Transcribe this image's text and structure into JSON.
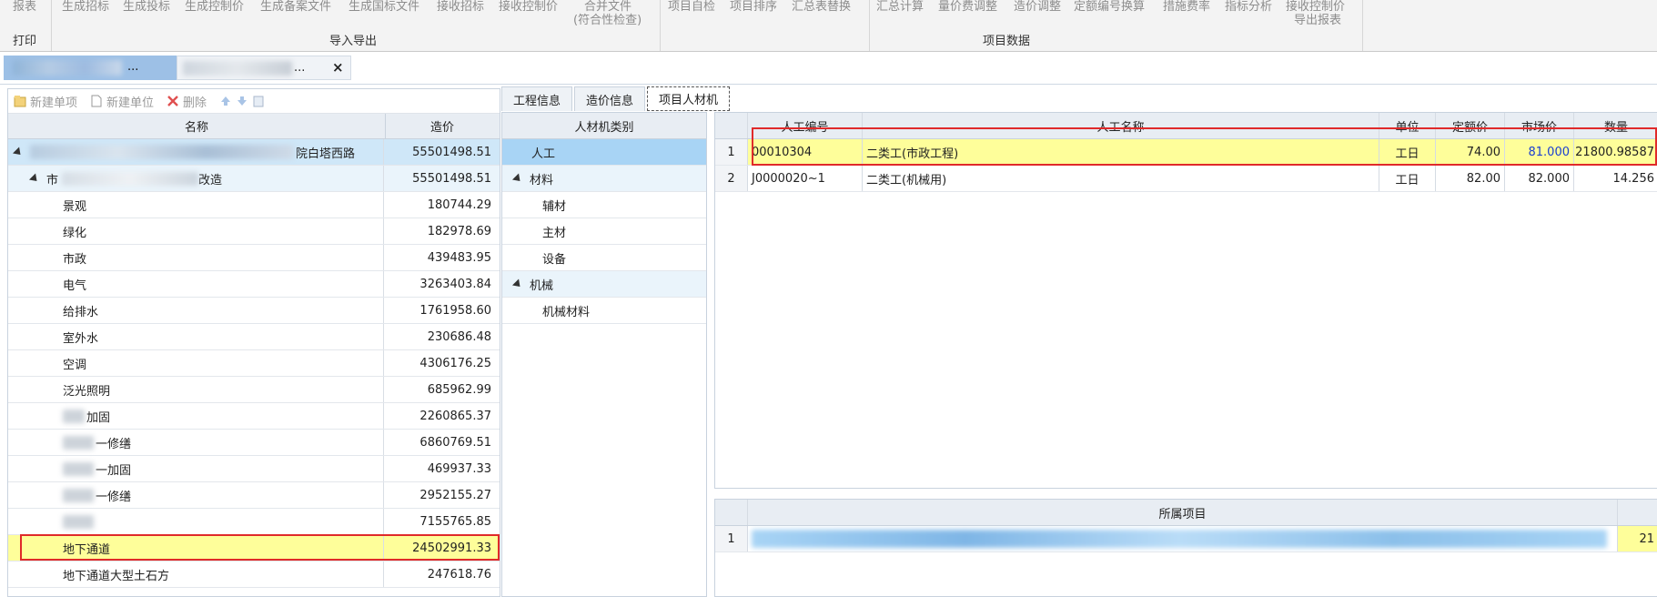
{
  "ribbon": {
    "print_items": [
      "报表"
    ],
    "print_group": "打印",
    "import_items": [
      "生成招标",
      "生成投标",
      "生成控制价",
      "生成备案文件",
      "生成国标文件",
      "接收招标",
      "接收控制价"
    ],
    "merge_line1": "合并文件",
    "merge_line2": "(符合性检查)",
    "import_group": "导入导出",
    "project_items_a": [
      "项目自检",
      "项目排序",
      "汇总表替换"
    ],
    "project_items_b": [
      "汇总计算",
      "量价费调整",
      "造价调整",
      "定额编号换算",
      "措施费率",
      "指标分析"
    ],
    "export_line1": "接收控制价",
    "export_line2": "导出报表",
    "project_group": "项目数据"
  },
  "doctabs": {
    "tab1_suffix": "...",
    "tab2_suffix": "...",
    "close": "×"
  },
  "left": {
    "toolbar": {
      "new_item": "新建单项",
      "new_unit": "新建单位",
      "delete": "删除"
    },
    "headers": {
      "name": "名称",
      "price": "造价"
    },
    "root": {
      "name_tail": "院白塔西路",
      "value": "55501498.51"
    },
    "sub": {
      "name_head": "市",
      "name_tail": "改造",
      "value": "55501498.51"
    },
    "rows": [
      {
        "name": "景观",
        "value": "180744.29"
      },
      {
        "name": "绿化",
        "value": "182978.69"
      },
      {
        "name": "市政",
        "value": "439483.95"
      },
      {
        "name": "电气",
        "value": "3263403.84"
      },
      {
        "name": "给排水",
        "value": "1761958.60"
      },
      {
        "name": "室外水",
        "value": "230686.48"
      },
      {
        "name": "空调",
        "value": "4306176.25"
      },
      {
        "name": "泛光照明",
        "value": "685962.99"
      },
      {
        "name": "加固",
        "value": "2260865.37"
      },
      {
        "name": "一修缮",
        "value": "6860769.51"
      },
      {
        "name": "一加固",
        "value": "469937.33"
      },
      {
        "name": "一修缮",
        "value": "2952155.27"
      },
      {
        "name": "",
        "value": "7155765.85"
      },
      {
        "name": "地下通道",
        "value": "24502991.33"
      },
      {
        "name": "地下通道大型土石方",
        "value": "247618.76"
      }
    ]
  },
  "tabs": [
    "工程信息",
    "造价信息",
    "项目人材机"
  ],
  "categories": {
    "header": "人材机类别",
    "items": [
      {
        "label": "人工",
        "type": "leaf-top"
      },
      {
        "label": "材料",
        "type": "group"
      },
      {
        "label": "辅材",
        "type": "child"
      },
      {
        "label": "主材",
        "type": "child"
      },
      {
        "label": "设备",
        "type": "child"
      },
      {
        "label": "机械",
        "type": "group"
      },
      {
        "label": "机械材料",
        "type": "child"
      }
    ]
  },
  "labor": {
    "headers": [
      "",
      "人工编号",
      "人工名称",
      "单位",
      "定额价",
      "市场价",
      "数量"
    ],
    "rows": [
      [
        "1",
        "00010304",
        "二类工(市政工程)",
        "工日",
        "74.00",
        "81.000",
        "21800.98587"
      ],
      [
        "2",
        "J0000020~1",
        "二类工(机械用)",
        "工日",
        "82.00",
        "82.000",
        "14.256"
      ]
    ]
  },
  "owner": {
    "header": "所属项目",
    "row_index": "1",
    "row_tail": "21"
  },
  "colors": {
    "highlight_yellow": "#fefe9a",
    "selected_blue": "#a8d4f5",
    "red_box": "#e02a2a",
    "market_price_blue": "#1a3fd0"
  }
}
